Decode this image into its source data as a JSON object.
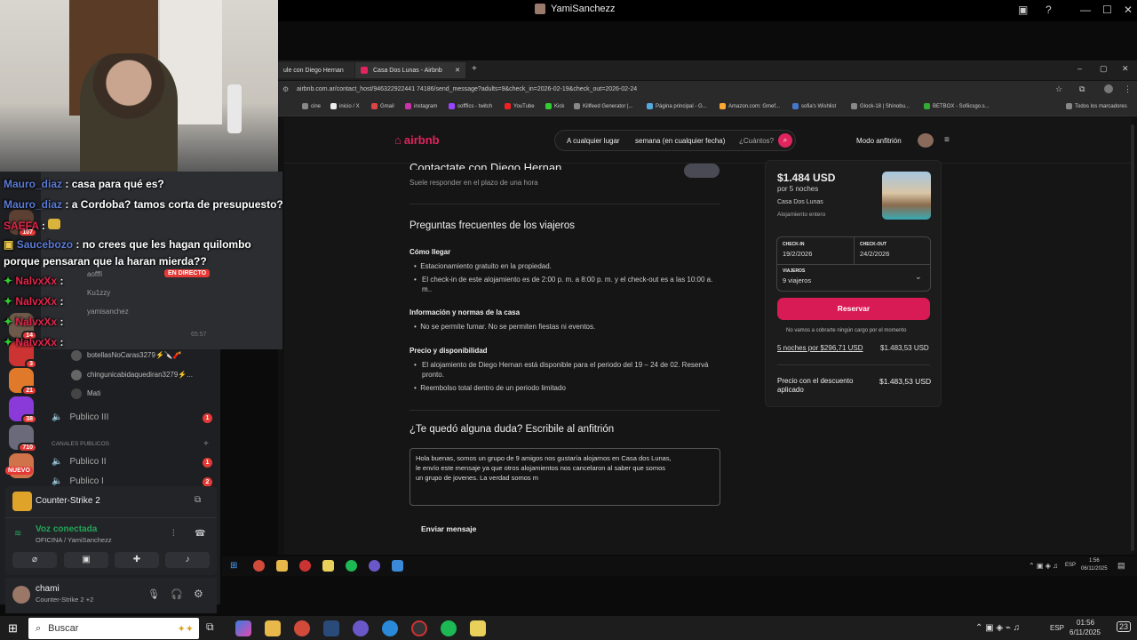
{
  "stream": {
    "window_title": "YamiSanchezz"
  },
  "chat": [
    {
      "user": "Mauro_diaz",
      "text": ": casa para qué es?"
    },
    {
      "user": "Mauro_diaz",
      "text": ": a Cordoba? tamos corta de presupuesto?"
    },
    {
      "user": "SAEFA",
      "text": ":"
    },
    {
      "user": "Saucebozo",
      "text": ": no crees que les hagan quilombo"
    },
    {
      "user": "",
      "text": "porque pensaran que la haran mierda??"
    },
    {
      "user": "NalvxXx",
      "text": ":"
    },
    {
      "user": "NalvxXx",
      "text": ":"
    },
    {
      "user": "NalvxXx",
      "text": ":"
    },
    {
      "user": "NalvxXx",
      "text": ":"
    }
  ],
  "discord": {
    "live_badge": "EN DIRECTO",
    "members": [
      "aofffi",
      "Ku1zzy",
      "yamisanchez",
      "botellasNoCaras3279⚡🔪🧨",
      "chingunicabidaquediran3279⚡...",
      "Mati"
    ],
    "timer": "65:57",
    "channels": [
      {
        "name": "Publico III",
        "badge": "1"
      },
      {
        "name": "Publico II",
        "badge": "1"
      },
      {
        "name": "Publico I",
        "badge": "2"
      }
    ],
    "category": "CANALES PUBLICOS",
    "server_badges": [
      "107",
      "14",
      "3",
      "21",
      "38",
      "710",
      "NUEVO"
    ],
    "game": "Counter-Strike 2",
    "voice_status": "Voz conectada",
    "voice_channel": "OFICINA / YamiSanchezz",
    "user_name": "chami",
    "user_activity": "Counter-Strike 2 +2"
  },
  "browser": {
    "tabs": [
      "ule con Diego Hernan",
      "Casa Dos Lunas - Airbnb"
    ],
    "url": "airbnb.com.ar/contact_host/946322922441 74186/send_message?adults=9&check_in=2026-02-19&check_out=2026-02-24",
    "bookmarks": [
      "cine",
      "inicio / X",
      "Gmail",
      "instagram",
      "sofffics - twitch",
      "YouTube",
      "Kick",
      "Killfeed Generator |...",
      "Página principal - G...",
      "Amazon.com: Gmef...",
      "sofia's Wishlist",
      "Glock-18 | Shinobu...",
      "BETBOX - Sofiicsgo.s..."
    ],
    "bookmarks_all": "Todos los marcadores"
  },
  "airbnb": {
    "logo": "airbnb",
    "search_where": "A cualquier lugar",
    "search_when": "semana (en cualquier fecha)",
    "search_who": "¿Cuántos?",
    "host_mode": "Modo anfitrión",
    "contact_title": "Contactate con Diego Hernan",
    "response_time": "Suele responder en el plazo de una hora",
    "faq_title": "Preguntas frecuentes de los viajeros",
    "sections": [
      {
        "title": "Cómo llegar",
        "items": [
          "Estacionamiento gratuito en la propiedad.",
          "El check-in de este alojamiento es de 2:00 p. m. a 8:00 p. m. y el check-out es a las 10:00 a. m.."
        ]
      },
      {
        "title": "Información y normas de la casa",
        "items": [
          "No se permite fumar. No se permiten fiestas ni eventos."
        ]
      },
      {
        "title": "Precio y disponibilidad",
        "items": [
          "El alojamiento de Diego Hernan está disponible para el periodo del 19 – 24 de 02. Reservá pronto.",
          "Reembolso total dentro de un periodo limitado"
        ]
      }
    ],
    "question_title": "¿Te quedó alguna duda? Escribile al anfitrión",
    "message": "Hola buenas, somos un grupo de 9 amigos nos gustaría alojarnos en Casa dos Lunas,\nle envío este mensaje ya que otros alojamientos nos cancelaron al saber que somos\nun grupo de jovenes. La verdad somos m",
    "send_label": "Enviar mensaje",
    "price": "$1.484 USD",
    "nights": "por 5 noches",
    "listing_name": "Casa Dos Lunas",
    "listing_type": "Alojamiento entero",
    "checkin_label": "CHECK-IN",
    "checkin": "19/2/2026",
    "checkout_label": "CHECK-OUT",
    "checkout": "24/2/2026",
    "guests_label": "VIAJEROS",
    "guests": "9 viajeros",
    "reserve_label": "Reservar",
    "no_charge": "No vamos a cobrarte ningún cargo por el momento",
    "breakdown_label": "5 noches por $296,71 USD",
    "breakdown_value": "$1.483,53 USD",
    "discount_label": "Precio con el descuento aplicado",
    "discount_value": "$1.483,53 USD"
  },
  "inner_taskbar": {
    "lang": "ESP",
    "time": "1:56",
    "date": "06/11/2025"
  },
  "taskbar": {
    "search_placeholder": "Buscar",
    "lang": "ESP",
    "time": "01:56",
    "date": "6/11/2025",
    "notif": "23"
  }
}
